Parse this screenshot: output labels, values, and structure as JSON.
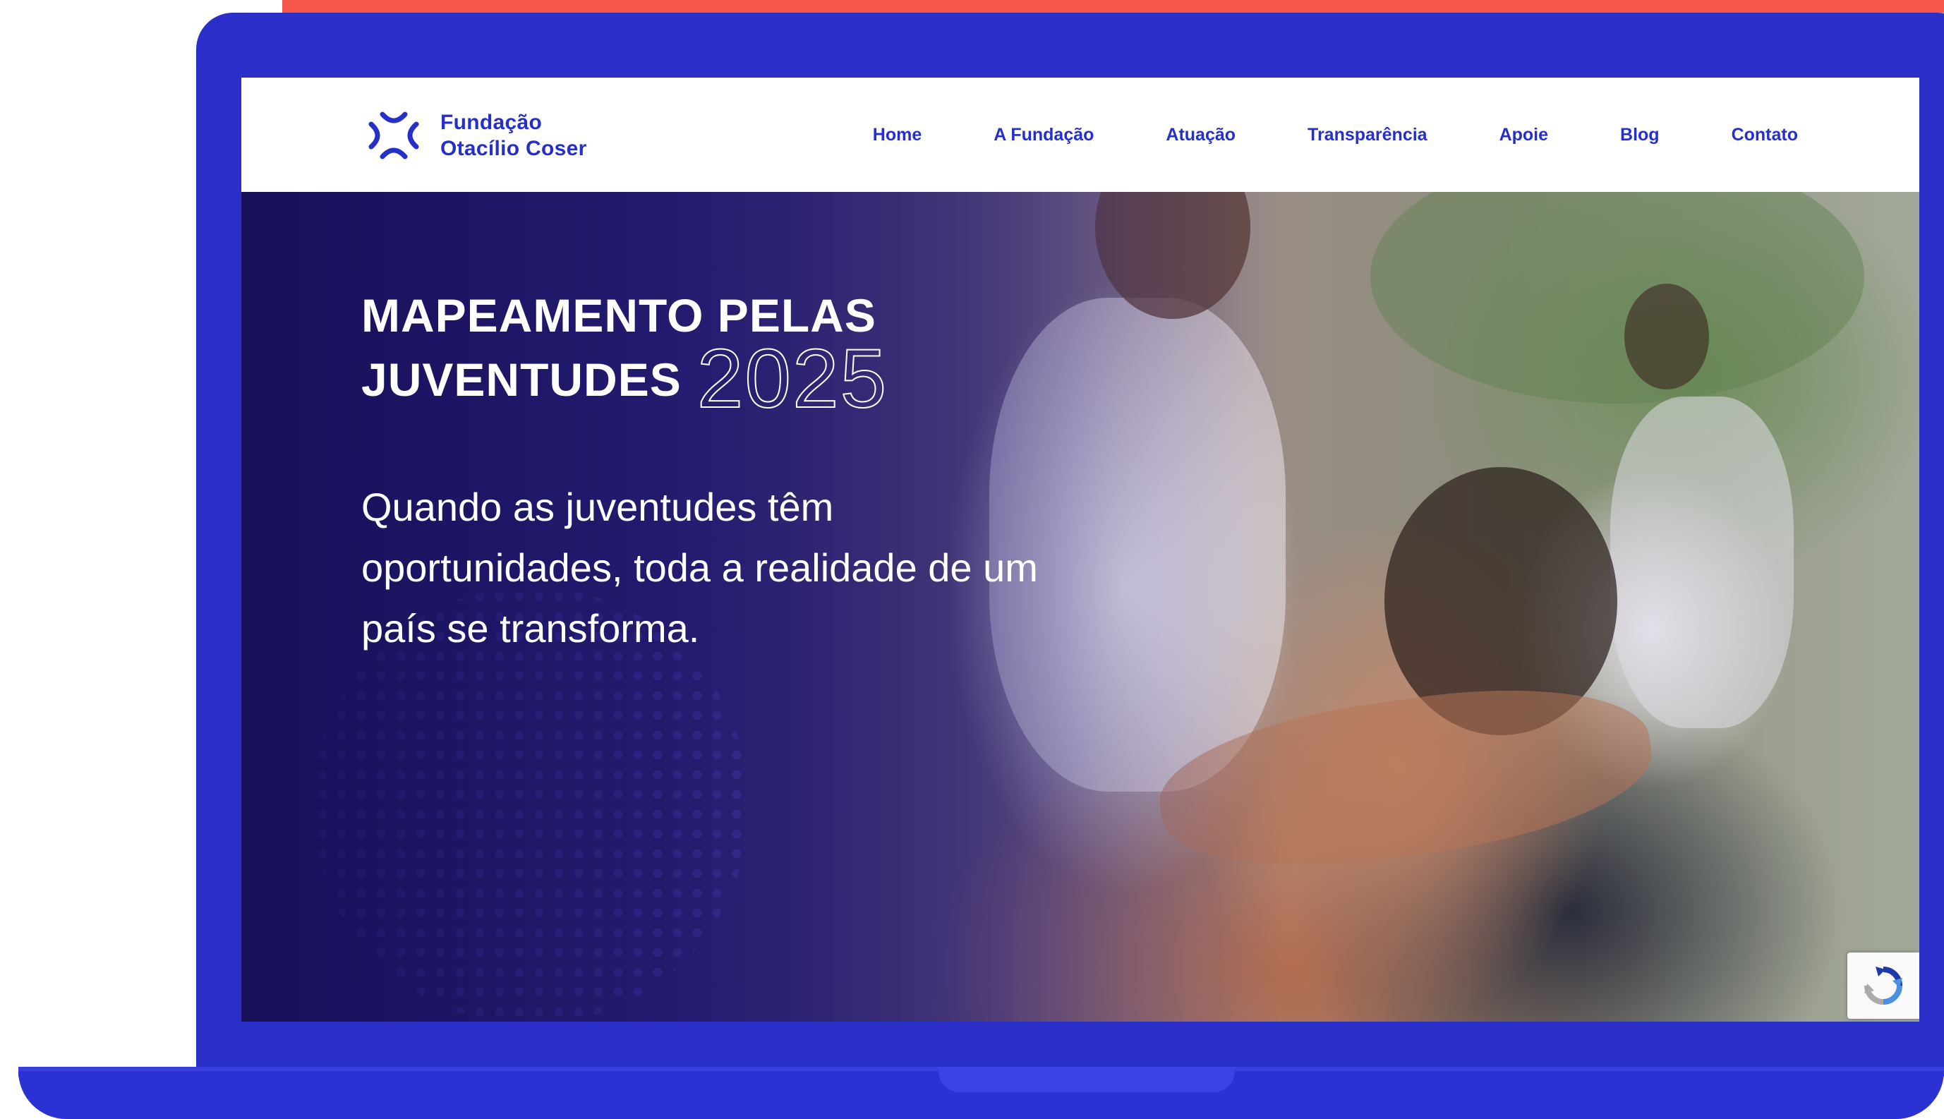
{
  "colors": {
    "brand_blue": "#2630c8",
    "laptop_blue": "#2a2fc9",
    "accent_coral": "#f4564a",
    "header_bg": "#ffffff",
    "hero_text": "#ffffff"
  },
  "logo": {
    "icon": "fundacao-logo-icon",
    "line1": "Fundação",
    "line2": "Otacílio Coser"
  },
  "nav": {
    "items": [
      {
        "label": "Home"
      },
      {
        "label": "A Fundação"
      },
      {
        "label": "Atuação"
      },
      {
        "label": "Transparência"
      },
      {
        "label": "Apoie"
      },
      {
        "label": "Blog"
      },
      {
        "label": "Contato"
      }
    ]
  },
  "hero": {
    "title_line1": "MAPEAMENTO PELAS",
    "title_line2": "JUVENTUDES",
    "year": "2025",
    "subtitle": "Quando as juventudes têm oportunidades, toda a realidade de um país se transforma."
  },
  "recaptcha": {
    "icon": "recaptcha-icon"
  }
}
